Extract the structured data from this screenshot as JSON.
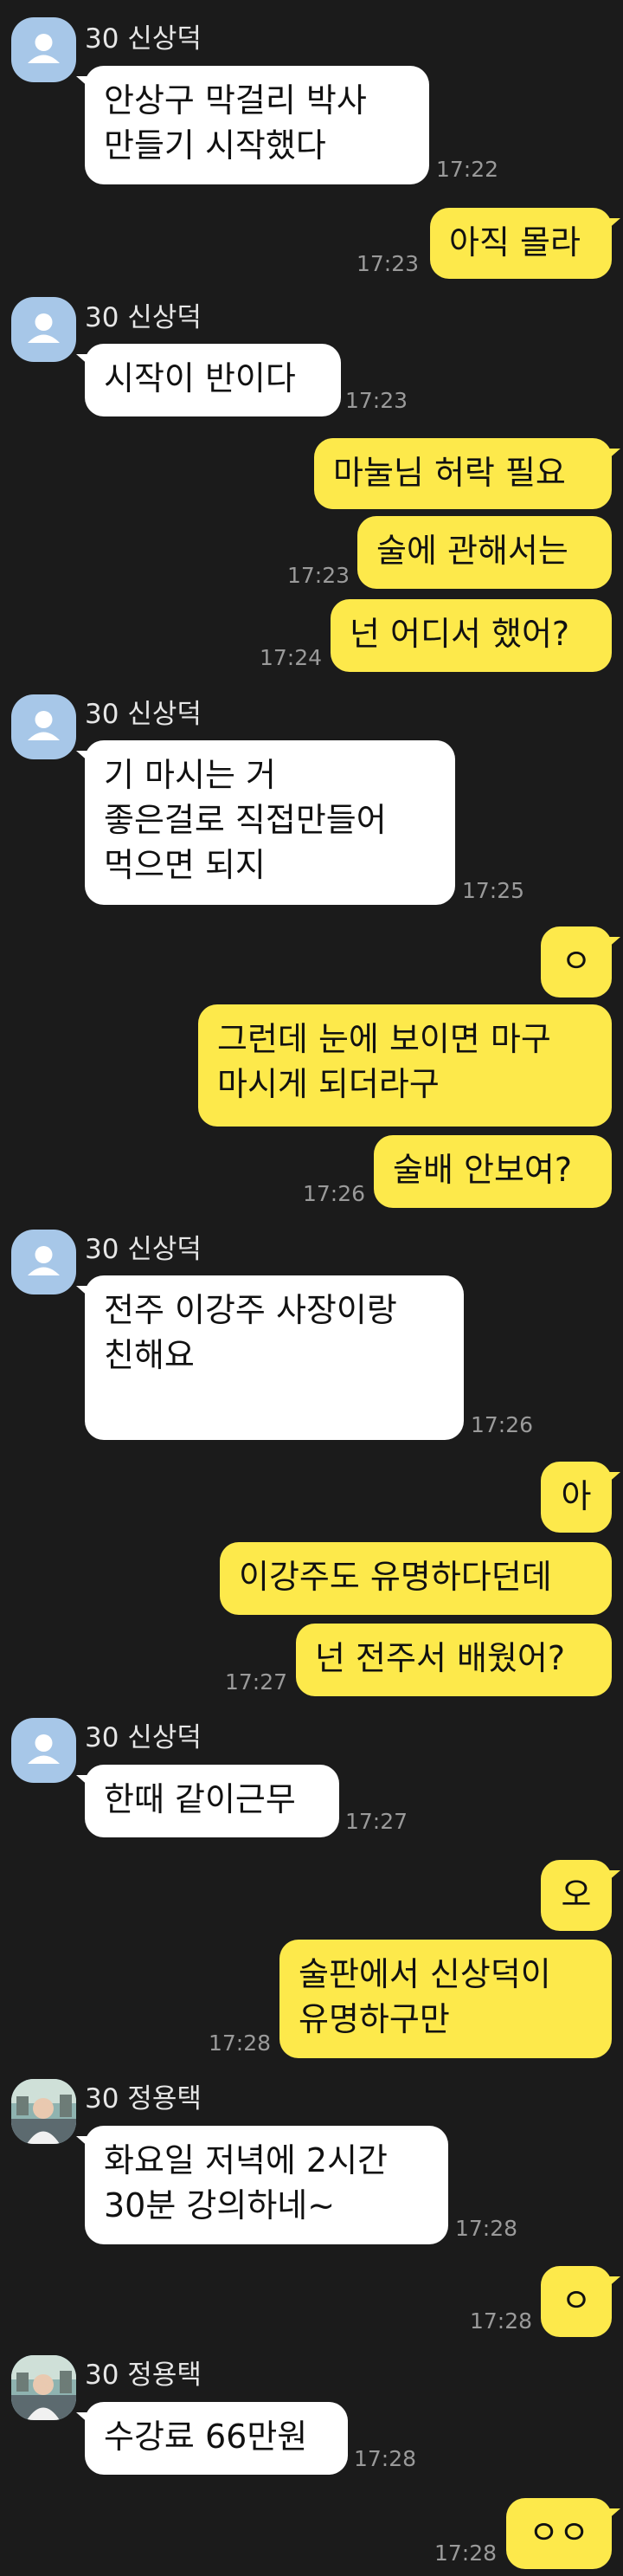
{
  "colors": {
    "background": "#1b1b1b",
    "incoming": "#ffffff",
    "outgoing": "#fde94b",
    "time": "#9a9a9a"
  },
  "messages": [
    {
      "from": "in",
      "sender": "30 신상덕",
      "avatar": "default-avatar-icon",
      "text": "안상구 막걸리 박사\n만들기 시작했다",
      "time": "17:22"
    },
    {
      "from": "out",
      "text": "아직 몰라",
      "time": "17:23"
    },
    {
      "from": "in",
      "sender": "30 신상덕",
      "avatar": "default-avatar-icon",
      "text": "시작이 반이다",
      "time": "17:23"
    },
    {
      "from": "out",
      "text": "마눌님 허락 필요",
      "time": ""
    },
    {
      "from": "out",
      "text": "술에 관해서는",
      "time": "17:23"
    },
    {
      "from": "out",
      "text": "넌 어디서 했어?",
      "time": "17:24"
    },
    {
      "from": "in",
      "sender": "30 신상덕",
      "avatar": "default-avatar-icon",
      "text": "기 마시는 거\n좋은걸로 직접만들어\n먹으면 되지",
      "time": "17:25"
    },
    {
      "from": "out",
      "text": "ㅇ",
      "time": ""
    },
    {
      "from": "out",
      "text": "그런데 눈에 보이면 마구\n마시게 되더라구",
      "time": ""
    },
    {
      "from": "out",
      "text": "술배 안보여?",
      "time": "17:26"
    },
    {
      "from": "in",
      "sender": "30 신상덕",
      "avatar": "default-avatar-icon",
      "text": "전주 이강주 사장이랑\n친해요",
      "time": "17:26"
    },
    {
      "from": "out",
      "text": "아",
      "time": ""
    },
    {
      "from": "out",
      "text": "이강주도 유명하다던데",
      "time": ""
    },
    {
      "from": "out",
      "text": "넌 전주서 배웠어?",
      "time": "17:27"
    },
    {
      "from": "in",
      "sender": "30 신상덕",
      "avatar": "default-avatar-icon",
      "text": "한때 같이근무",
      "time": "17:27"
    },
    {
      "from": "out",
      "text": "오",
      "time": ""
    },
    {
      "from": "out",
      "text": "술판에서 신상덕이\n유명하구만",
      "time": "17:28"
    },
    {
      "from": "in",
      "sender": "30 정용택",
      "avatar": "photo-avatar-icon",
      "text": "화요일 저녁에 2시간\n30분 강의하네~",
      "time": "17:28"
    },
    {
      "from": "out",
      "text": "ㅇ",
      "time": "17:28"
    },
    {
      "from": "in",
      "sender": "30 정용택",
      "avatar": "photo-avatar-icon",
      "text": "수강료 66만원",
      "time": "17:28"
    },
    {
      "from": "out",
      "text": "ㅇㅇ",
      "time": "17:28"
    }
  ]
}
